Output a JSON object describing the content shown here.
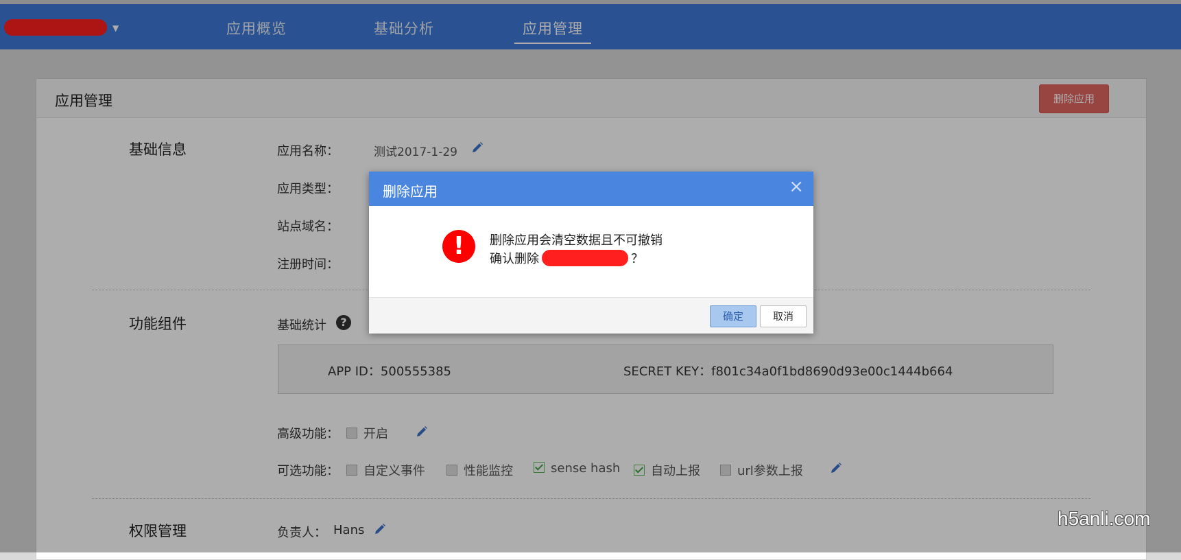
{
  "navbar": {
    "items": [
      {
        "label": "应用概览",
        "active": false
      },
      {
        "label": "基础分析",
        "active": false
      },
      {
        "label": "应用管理",
        "active": true
      }
    ]
  },
  "panel": {
    "title": "应用管理",
    "delete_button": "删除应用"
  },
  "basic_info": {
    "section_title": "基础信息",
    "name_label": "应用名称：",
    "name_value": "测试2017-1-29",
    "type_label": "应用类型：",
    "domain_label": "站点域名：",
    "register_label": "注册时间："
  },
  "features": {
    "section_title": "功能组件",
    "basic_stats_label": "基础统计",
    "app_id": "APP ID：500555385",
    "secret_key": "SECRET KEY：f801c34a0f1bd8690d93e00c1444b664",
    "advanced_label": "高级功能：",
    "advanced_option": {
      "label": "开启",
      "checked": false
    },
    "optional_label": "可选功能：",
    "optional_options": [
      {
        "label": "自定义事件",
        "checked": false
      },
      {
        "label": "性能监控",
        "checked": false
      },
      {
        "label": "sense hash",
        "checked": true
      },
      {
        "label": "自动上报",
        "checked": true
      },
      {
        "label": "url参数上报",
        "checked": false
      }
    ]
  },
  "permissions": {
    "section_title": "权限管理",
    "owner_label": "负责人：",
    "owner_value": "Hans"
  },
  "modal": {
    "title": "删除应用",
    "close_symbol": "×",
    "alert_symbol": "!",
    "message_line1": "删除应用会清空数据且不可撤销",
    "message_line2_prefix": "确认删除",
    "message_line2_suffix": "？",
    "confirm_button": "确定",
    "cancel_button": "取消"
  },
  "watermark": "h5anli.com",
  "colors": {
    "navbar": "#3f78d6",
    "modal_header": "#4a86e0",
    "danger": "#e0655f",
    "alert_red": "#ff0000"
  }
}
